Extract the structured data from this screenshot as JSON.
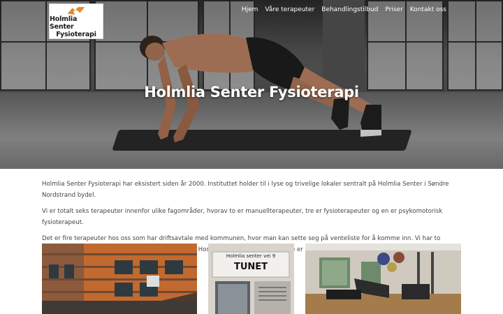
{
  "brand": {
    "logo_line1": "Holmlia Senter",
    "logo_line2": "Fysioterapi",
    "logo_colors": {
      "primary": "#e8882a",
      "dark": "#1a1a1a"
    }
  },
  "nav": {
    "items": [
      {
        "label": "Hjem"
      },
      {
        "label": "Våre terapeuter"
      },
      {
        "label": "Behandlingstilbud"
      },
      {
        "label": "Priser"
      },
      {
        "label": "Kontakt oss"
      }
    ]
  },
  "hero": {
    "title": "Holmlia Senter Fysioterapi"
  },
  "intro": {
    "paragraphs": [
      "Holmlia Senter Fysioterapi har eksistert siden år 2000. Instituttet holder til i lyse og trivelige lokaler sentralt på Holmlia Senter i Søndre Nordstrand bydel.",
      "Vi er totalt seks terapeuter innenfor ulike fagområder, hvorav to er manuellterapeuter, tre er fysioterapeuter og en er psykomotorisk fysioterapeut.",
      "Det er fire terapeuter hos oss som har driftsavtale med kommunen, hvor man kan sette seg på venteliste for å komme inn. Vi har to terapeuter som jobber helprivat (uten driftsavtale). Hos de private fysioterapeutene er det ingen venteliste."
    ]
  },
  "gallery": {
    "sign_line1": "Holmlia senter vei 9",
    "sign_line2": "TUNET"
  }
}
